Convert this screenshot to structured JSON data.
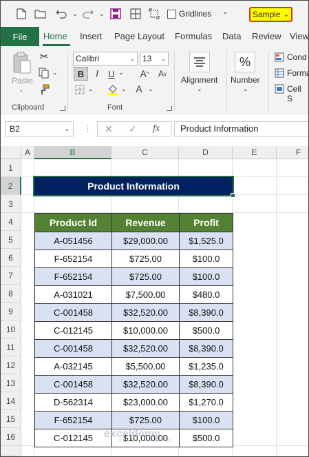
{
  "qat": {
    "gridlines_label": "Gridlines",
    "dropdown_glyph": "⌄",
    "sample_label": "Sample",
    "sample_chevron": "⌄"
  },
  "tabs": [
    "File",
    "Home",
    "Insert",
    "Page Layout",
    "Formulas",
    "Data",
    "Review",
    "View"
  ],
  "ribbon": {
    "clipboard": {
      "paste_label": "Paste",
      "group_label": "Clipboard"
    },
    "font": {
      "font_name": "Calibri",
      "font_size": "13",
      "bold": "B",
      "italic": "I",
      "underline": "U",
      "grow": "A",
      "shrink": "A",
      "color_a": "A",
      "group_label": "Font"
    },
    "alignment": {
      "label": "Alignment"
    },
    "number": {
      "label": "Number",
      "symbol": "%"
    },
    "styles": {
      "cond": "Cond",
      "format": "Forma",
      "cell": "Cell S"
    }
  },
  "formula_bar": {
    "name_box": "B2",
    "content": "Product Information"
  },
  "grid": {
    "columns": [
      "A",
      "B",
      "C",
      "D",
      "E",
      "F"
    ],
    "rows": [
      "1",
      "2",
      "3",
      "4",
      "5",
      "6",
      "7",
      "8",
      "9",
      "10",
      "11",
      "12",
      "13",
      "14",
      "15",
      "16"
    ],
    "title": "Product Information",
    "headers": [
      "Product Id",
      "Revenue",
      "Profit"
    ],
    "data": [
      [
        "A-051456",
        "$29,000.00",
        "$1,525.0"
      ],
      [
        "F-652154",
        "$725.00",
        "$100.0"
      ],
      [
        "F-652154",
        "$725.00",
        "$100.0"
      ],
      [
        "A-031021",
        "$7,500.00",
        "$480.0"
      ],
      [
        "C-001458",
        "$32,520.00",
        "$8,390.0"
      ],
      [
        "C-012145",
        "$10,000.00",
        "$500.0"
      ],
      [
        "C-001458",
        "$32,520.00",
        "$8,390.0"
      ],
      [
        "A-032145",
        "$5,500.00",
        "$1,235.0"
      ],
      [
        "C-001458",
        "$32,520.00",
        "$8,390.0"
      ],
      [
        "D-562314",
        "$23,000.00",
        "$1,270.0"
      ],
      [
        "F-652154",
        "$725.00",
        "$100.0"
      ],
      [
        "C-012145",
        "$10,000.00",
        "$500.0"
      ]
    ]
  },
  "colors": {
    "excel_green": "#217346",
    "title_fill": "#002060",
    "header_fill": "#548235",
    "band_fill": "#d9e1f2",
    "sample_fill": "#ffff00",
    "sample_border": "#d9342b"
  },
  "watermark": {
    "brand": "exceldemy",
    "tagline": "EXCEL · DATA · BI"
  }
}
